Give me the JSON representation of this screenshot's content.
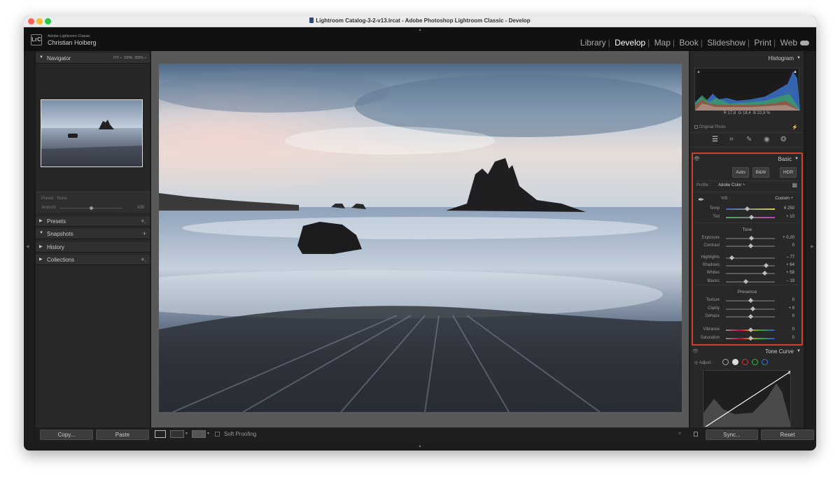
{
  "window": {
    "title": "Lightroom Catalog-3-2-v13.lrcat - Adobe Photoshop Lightroom Classic - Develop"
  },
  "identity": {
    "logo": "LrC",
    "app": "Adobe Lightroom Classic",
    "user": "Christian Hoiberg"
  },
  "modules": [
    "Library",
    "Develop",
    "Map",
    "Book",
    "Slideshow",
    "Print",
    "Web"
  ],
  "active_module": "Develop",
  "left": {
    "navigator": {
      "title": "Navigator",
      "zooms": [
        "FIT ÷",
        "100%",
        "300% ÷"
      ]
    },
    "preset": {
      "label": "Preset : None",
      "amount_label": "Amount",
      "amount_value": "100"
    },
    "panels": [
      "Presets",
      "Snapshots",
      "History",
      "Collections"
    ],
    "copy": "Copy...",
    "paste": "Paste"
  },
  "toolbar": {
    "soft_proofing": "Soft Proofing",
    "view_icons": [
      "loupe-icon",
      "before-after-icon",
      "yy-icon"
    ]
  },
  "right": {
    "histogram": {
      "title": "Histogram",
      "r_label": "R",
      "r": "17,8",
      "g_label": "G",
      "g": "18,4",
      "b_label": "B",
      "b": "22,9",
      "unit": "%",
      "original": "Original Photo"
    },
    "basic": {
      "title": "Basic",
      "modes": [
        "Auto",
        "B&W",
        "HDR"
      ],
      "profile_label": "Profile :",
      "profile_value": "Adobe Color ÷",
      "wb_label": "WB :",
      "wb_value": "Custom ÷",
      "tone_title": "Tone",
      "presence_title": "Presence",
      "sliders": [
        {
          "label": "Temp",
          "value": "6 250",
          "pos": 0.43,
          "color": "temp"
        },
        {
          "label": "Tint",
          "value": "+ 10",
          "pos": 0.52,
          "color": "tint"
        },
        {
          "label": "Exposure",
          "value": "+ 0,20",
          "pos": 0.52,
          "color": "gray"
        },
        {
          "label": "Contrast",
          "value": "0",
          "pos": 0.5,
          "color": "gray"
        },
        {
          "label": "Highlights",
          "value": "– 77",
          "pos": 0.12,
          "color": "gray"
        },
        {
          "label": "Shadows",
          "value": "+ 64",
          "pos": 0.82,
          "color": "gray"
        },
        {
          "label": "Whites",
          "value": "+ 58",
          "pos": 0.79,
          "color": "gray"
        },
        {
          "label": "Blacks",
          "value": "– 19",
          "pos": 0.4,
          "color": "gray"
        },
        {
          "label": "Texture",
          "value": "0",
          "pos": 0.5,
          "color": "gray"
        },
        {
          "label": "Clarity",
          "value": "+ 9",
          "pos": 0.55,
          "color": "gray"
        },
        {
          "label": "Dehaze",
          "value": "0",
          "pos": 0.5,
          "color": "gray"
        },
        {
          "label": "Vibrance",
          "value": "0",
          "pos": 0.5,
          "color": "vib"
        },
        {
          "label": "Saturation",
          "value": "0",
          "pos": 0.5,
          "color": "vib"
        }
      ]
    },
    "tone_curve": {
      "title": "Tone Curve",
      "adjust": "Adjust :"
    },
    "sync": "Sync...",
    "reset": "Reset"
  }
}
